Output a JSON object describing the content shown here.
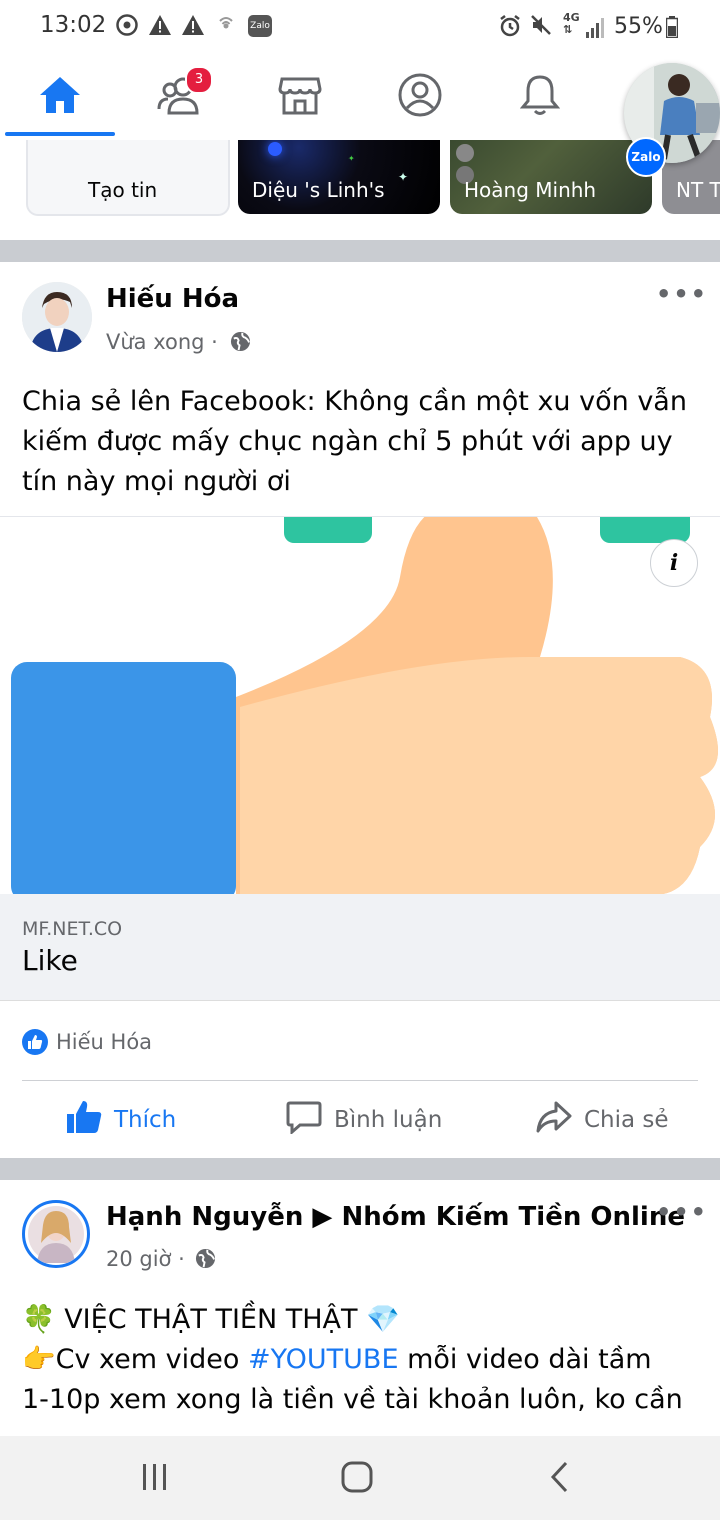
{
  "status_bar": {
    "time": "13:02",
    "zalo_label": "Zalo",
    "battery": "55%",
    "network": "4G",
    "icons": [
      "chrome-icon",
      "warning-icon",
      "warning-icon",
      "wifi-call-icon",
      "zalo-icon",
      "alarm-icon",
      "mute-icon",
      "network-4g-icon",
      "signal-icon",
      "battery-icon"
    ]
  },
  "nav": {
    "items": [
      "home-icon",
      "friends-icon",
      "marketplace-icon",
      "profile-icon",
      "notifications-icon"
    ],
    "friends_badge": "3",
    "active": "home",
    "accent": "#1877f2"
  },
  "floating": {
    "zalo_badge": "Zalo"
  },
  "stories": [
    {
      "label": "Tạo tin"
    },
    {
      "label": "Diệu 's Linh's"
    },
    {
      "label": "Hoàng Minhh"
    },
    {
      "label": "NT T"
    }
  ],
  "post1": {
    "author": "Hiếu Hóa",
    "time": "Vừa xong ·",
    "text": "Chia sẻ lên Facebook: Không cần một xu vốn vẫn kiếm được mấy chục ngàn chỉ 5 phút với app uy tín này mọi người ơi",
    "link_domain": "MF.NET.CO",
    "link_title": "Like",
    "info_label": "i",
    "reaction_names": "Hiếu Hóa",
    "actions": {
      "like": "Thích",
      "comment": "Bình luận",
      "share": "Chia sẻ"
    }
  },
  "post2": {
    "author": "Hạnh Nguyễn ▶ Nhóm Kiếm Tiền Online",
    "time": "20 giờ ·",
    "line1": "🍀 VIỆC THẬT TIỀN THẬT 💎",
    "line2_prefix": "👉Cv xem video ",
    "line2_hashtag": "#YOUTUBE",
    "line2_suffix": " mỗi video dài tầm",
    "line3": "1-10p xem xong là tiền về tài khoản luôn, ko cần"
  },
  "android_nav": [
    "recents-icon",
    "home-button-icon",
    "back-icon"
  ]
}
